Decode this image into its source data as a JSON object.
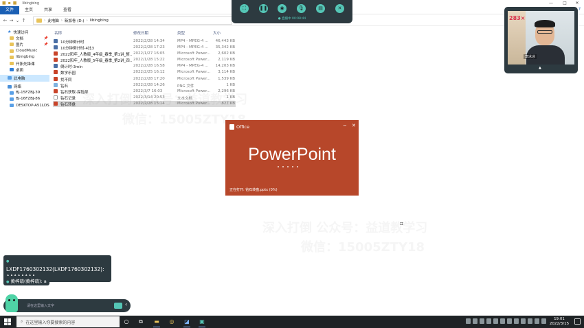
{
  "window": {
    "title": "libingbing",
    "controls": {
      "minimize": "—",
      "maximize": "□",
      "close": "✕"
    }
  },
  "ribbon": {
    "tabs": [
      "文件",
      "主页",
      "共享",
      "查看"
    ],
    "help": "?"
  },
  "address": {
    "back": "←",
    "forward": "→",
    "recent": "⌄",
    "up": "↑",
    "crumbs": [
      "此电脑",
      "新加卷 (D:)",
      "libingbing"
    ],
    "separator": "›"
  },
  "nav_pane": {
    "items": [
      {
        "label": "快速访问",
        "icon": "star-icon",
        "pinned": false
      },
      {
        "label": "文档",
        "icon": "folder-icon",
        "pinned": true
      },
      {
        "label": "图片",
        "icon": "folder-icon",
        "pinned": true
      },
      {
        "label": "CloudMusic",
        "icon": "folder-icon",
        "pinned": false
      },
      {
        "label": "libingbing",
        "icon": "folder-icon",
        "pinned": false
      },
      {
        "label": "开拓先锋课",
        "icon": "folder-icon",
        "pinned": false
      },
      {
        "label": "桌面",
        "icon": "desktop-icon",
        "pinned": false
      },
      {
        "label": "此电脑",
        "icon": "pc-icon",
        "pinned": false
      },
      {
        "label": "网络",
        "icon": "network-icon",
        "pinned": false
      },
      {
        "label": "BJ-15FZBJ-39",
        "icon": "computer-icon",
        "pinned": false
      },
      {
        "label": "BJ-16FZBJ-86",
        "icon": "computer-icon",
        "pinned": false
      },
      {
        "label": "DESKTOP-A51LDS",
        "icon": "computer-icon",
        "pinned": false
      }
    ],
    "pin_glyph": "📌"
  },
  "file_list": {
    "columns": [
      "名称",
      "修改日期",
      "类型",
      "大小"
    ],
    "rows": [
      {
        "icon": "mp4",
        "name": "10分钟倒计时",
        "date": "2022/2/28 14:34",
        "type": "MP4 - MPEG-4 ...",
        "size": "46,443 KB"
      },
      {
        "icon": "mp4",
        "name": "10分钟倒计时-4比3",
        "date": "2022/2/28 17:23",
        "type": "MP4 - MPEG-4 ...",
        "size": "35,342 KB"
      },
      {
        "icon": "ppt",
        "name": "2022阳年_人教版_4年级_春季_第1讲_整...",
        "date": "2022/1/27 16:05",
        "type": "Microsoft Power...",
        "size": "2,602 KB"
      },
      {
        "icon": "ppt",
        "name": "2022阳年_人教版_5年级_春季_第2讲_四...",
        "date": "2022/1/28 15:22",
        "type": "Microsoft Power...",
        "size": "2,119 KB"
      },
      {
        "icon": "mp4",
        "name": "倒计时-3min",
        "date": "2022/2/28 16:58",
        "type": "MP4 - MPEG-4 ...",
        "size": "14,203 KB"
      },
      {
        "icon": "ppt",
        "name": "数学乐园",
        "date": "2022/2/25 16:12",
        "type": "Microsoft Power...",
        "size": "3,114 KB"
      },
      {
        "icon": "ppt",
        "name": "找不同",
        "date": "2022/2/28 17:20",
        "type": "Microsoft Power...",
        "size": "1,539 KB"
      },
      {
        "icon": "png",
        "name": "钻石",
        "date": "2022/2/28 14:26",
        "type": "PNG 文件",
        "size": "1 KB"
      },
      {
        "icon": "ppt",
        "name": "钻石获取-探险部",
        "date": "2022/3/7 16:03",
        "type": "Microsoft Power...",
        "size": "2,296 KB"
      },
      {
        "icon": "txt",
        "name": "钻石记录",
        "date": "2022/3/14 20:53",
        "type": "文本文档",
        "size": "1 KB"
      },
      {
        "icon": "ppt",
        "name": "钻石转盘",
        "date": "2022/2/28 15:14",
        "type": "Microsoft Power...",
        "size": "827 KB",
        "selected": true
      }
    ]
  },
  "watermark": {
    "line1": "深入打倒 公众号：益道教学习",
    "line2": "微信：15005ZTY18"
  },
  "splash": {
    "brand": "Office",
    "minimize": "−",
    "close": "✕",
    "title": "PowerPoint",
    "status": "正在打开: 钻石转盘.pptx (0%)",
    "color": "#b7472a"
  },
  "toolbar": {
    "buttons": [
      {
        "name": "screenshot",
        "glyph": "⛶"
      },
      {
        "name": "pause",
        "glyph": "❚❚"
      },
      {
        "name": "camera",
        "glyph": "◉"
      },
      {
        "name": "microphone",
        "glyph": "🎙"
      },
      {
        "name": "whiteboard",
        "glyph": "▤"
      },
      {
        "name": "close",
        "glyph": "✕"
      }
    ],
    "status_text": "● 直播中 00:08:44",
    "accent": "#55c6b6"
  },
  "webcam": {
    "score": "283×",
    "name_tag": "李冰冰",
    "collapse": "▲"
  },
  "chat": {
    "messages": [
      {
        "text": "LXDF1760302132(LXDF1760302132): AAAAAAAA"
      },
      {
        "text": "黄梓萌(黄梓萌): a"
      }
    ],
    "input_placeholder": "请在这里输入文字",
    "send": "➤",
    "toggle": "‹"
  },
  "taskbar": {
    "search_placeholder": "在这里输入你要搜索的内容",
    "search_glyph": "⌕",
    "apps": [
      "○",
      "⧉",
      "▬",
      "◎",
      "◪",
      "▣"
    ],
    "time": "19:01",
    "date": "2022/3/15"
  }
}
